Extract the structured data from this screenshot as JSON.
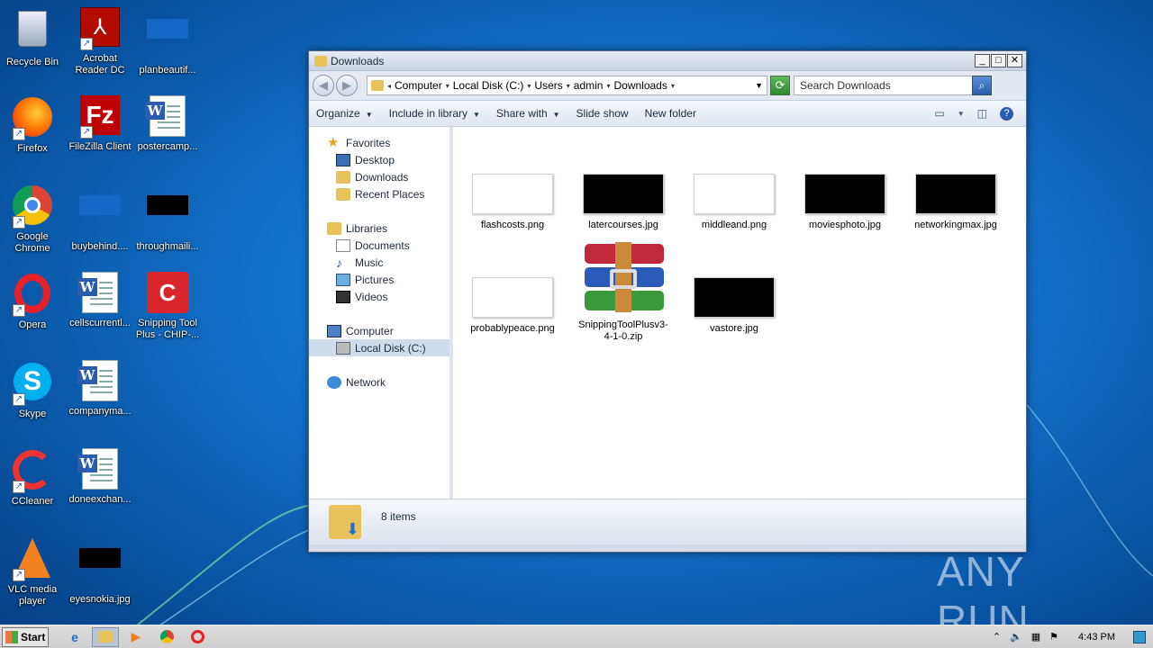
{
  "desktop": {
    "icons": [
      {
        "label": "Recycle Bin"
      },
      {
        "label": "Acrobat Reader DC"
      },
      {
        "label": "planbeautif..."
      },
      {
        "label": "Firefox"
      },
      {
        "label": "FileZilla Client"
      },
      {
        "label": "postercamp..."
      },
      {
        "label": "Google Chrome"
      },
      {
        "label": "buybehind...."
      },
      {
        "label": "throughmaili..."
      },
      {
        "label": "Opera"
      },
      {
        "label": "cellscurrentl..."
      },
      {
        "label": "Snipping Tool Plus - CHIP-..."
      },
      {
        "label": "Skype"
      },
      {
        "label": "companyma..."
      },
      {
        "label": "CCleaner"
      },
      {
        "label": "doneexchan..."
      },
      {
        "label": "VLC media player"
      },
      {
        "label": "eyesnokia.jpg"
      }
    ]
  },
  "window": {
    "title": "Downloads",
    "controls": {
      "minimize": "_",
      "maximize": "□",
      "close": "✕"
    },
    "breadcrumbs": [
      "Computer",
      "Local Disk (C:)",
      "Users",
      "admin",
      "Downloads"
    ],
    "search_placeholder": "Search Downloads",
    "toolbar": {
      "organize": "Organize",
      "include": "Include in library",
      "share": "Share with",
      "slideshow": "Slide show",
      "newfolder": "New folder"
    },
    "nav": {
      "favorites": "Favorites",
      "desktop": "Desktop",
      "downloads": "Downloads",
      "recent": "Recent Places",
      "libraries": "Libraries",
      "documents": "Documents",
      "music": "Music",
      "pictures": "Pictures",
      "videos": "Videos",
      "computer": "Computer",
      "localdisk": "Local Disk (C:)",
      "network": "Network"
    },
    "files": [
      {
        "name": "flashcosts.png",
        "thumb": "white"
      },
      {
        "name": "latercourses.jpg",
        "thumb": "black"
      },
      {
        "name": "middleand.png",
        "thumb": "white"
      },
      {
        "name": "moviesphoto.jpg",
        "thumb": "black"
      },
      {
        "name": "networkingmax.jpg",
        "thumb": "black"
      },
      {
        "name": "probablypeace.png",
        "thumb": "white"
      },
      {
        "name": "SnippingToolPlusv3-4-1-0.zip",
        "thumb": "zip"
      },
      {
        "name": "vastore.jpg",
        "thumb": "black"
      }
    ],
    "status": "8 items"
  },
  "taskbar": {
    "start": "Start",
    "clock": "4:43 PM"
  },
  "watermark": "ANY RUN"
}
